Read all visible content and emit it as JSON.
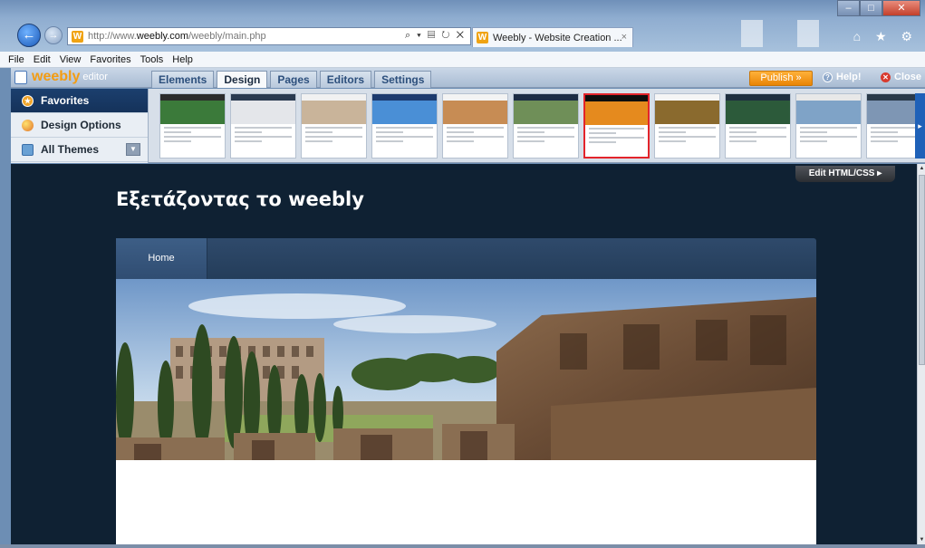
{
  "browser": {
    "url_prefix": "http://www.",
    "url_domain": "weebly.com",
    "url_path": "/weebly/main.php",
    "address_tools": "⌕ ▾ ▤ ↻ ✕",
    "tab_title": "Weebly - Website Creation ...",
    "tab_close": "×",
    "logo_letter": "W",
    "window_minimize": "–",
    "window_maximize": "□",
    "window_close": "✕",
    "chrome_icons": "⌂ ★ ⚙"
  },
  "menubar": [
    "File",
    "Edit",
    "View",
    "Favorites",
    "Tools",
    "Help"
  ],
  "editor": {
    "brand": "weebly",
    "brand_sub": "editor",
    "tabs": [
      "Elements",
      "Design",
      "Pages",
      "Editors",
      "Settings"
    ],
    "active_tab": "Design",
    "publish_label": "Publish »",
    "help_label": "Help!",
    "close_label": "Close"
  },
  "design_panel": {
    "side_items": [
      "Favorites",
      "Design Options",
      "All Themes"
    ],
    "thumbnail_count": 11,
    "selected_thumbnail": 6,
    "next_arrow": "▸"
  },
  "site": {
    "edit_html_label": "Edit HTML/CSS ▸",
    "title": "Εξετάζοντας το weebly",
    "nav_items": [
      "Home"
    ]
  },
  "colors": {
    "publish": "#f0950f",
    "selected_border": "#e3242b",
    "site_background": "#0f2133",
    "nav_background": "#2b4465"
  }
}
